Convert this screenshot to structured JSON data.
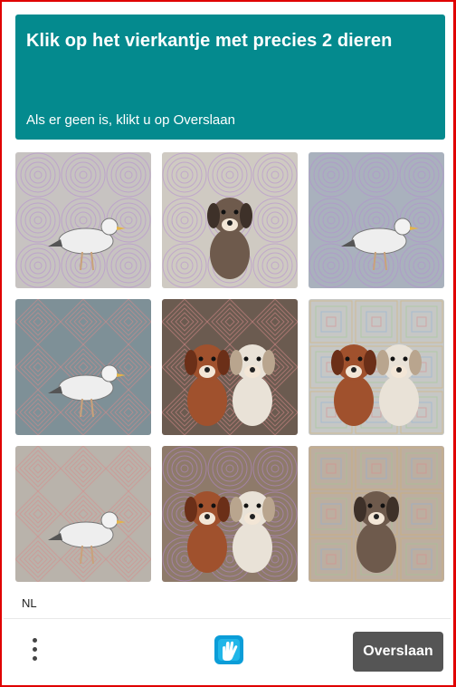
{
  "header": {
    "title": "Klik op het vierkantje met precies 2 dieren",
    "subtitle": "Als er geen is, klikt u op Overslaan",
    "background": "#048a8e"
  },
  "tiles": [
    {
      "subject": "bird",
      "pattern": "circles"
    },
    {
      "subject": "puppy",
      "pattern": "circles"
    },
    {
      "subject": "bird",
      "pattern": "circles"
    },
    {
      "subject": "bird",
      "pattern": "diamonds"
    },
    {
      "subject": "two-puppies",
      "pattern": "diamonds"
    },
    {
      "subject": "two-puppies",
      "pattern": "squares"
    },
    {
      "subject": "bird",
      "pattern": "diamonds"
    },
    {
      "subject": "two-puppies",
      "pattern": "circles"
    },
    {
      "subject": "puppy",
      "pattern": "squares"
    }
  ],
  "footer": {
    "language": "NL",
    "menu_icon": "vertical-dots-icon",
    "logo_icon": "hcaptcha-hand-logo",
    "skip_label": "Overslaan",
    "skip_color": "#555555"
  }
}
